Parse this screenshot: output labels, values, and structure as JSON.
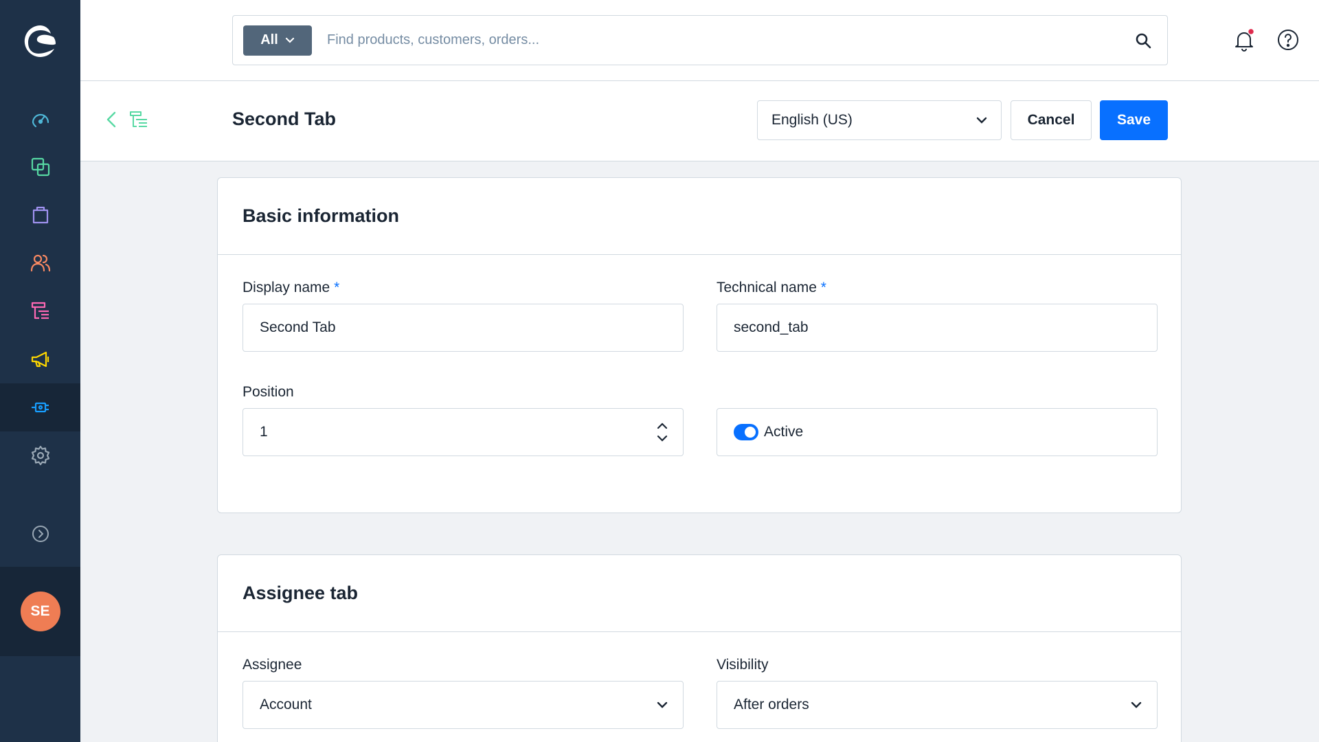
{
  "sidebar": {
    "items": [
      {
        "icon": "dashboard-icon",
        "color": "#4fb8d8"
      },
      {
        "icon": "catalogue-icon",
        "color": "#57d9a3"
      },
      {
        "icon": "orders-icon",
        "color": "#a092f0"
      },
      {
        "icon": "customers-icon",
        "color": "#f88962"
      },
      {
        "icon": "content-icon",
        "color": "#ff68b4"
      },
      {
        "icon": "marketing-icon",
        "color": "#ffd700"
      },
      {
        "icon": "extensions-icon",
        "color": "#189eff",
        "active": true
      },
      {
        "icon": "settings-icon",
        "color": "#9aa8b5"
      }
    ],
    "expand_icon": "chevron-right-circle-icon",
    "avatar_initials": "SE",
    "avatar_color": "#ef7d54"
  },
  "search": {
    "type_label": "All",
    "placeholder": "Find products, customers, orders..."
  },
  "header": {
    "title": "Second Tab",
    "language": "English (US)",
    "cancel_label": "Cancel",
    "save_label": "Save"
  },
  "basic_info": {
    "title": "Basic information",
    "display_name_label": "Display name",
    "display_name_value": "Second Tab",
    "technical_name_label": "Technical name",
    "technical_name_value": "second_tab",
    "required_marker": "*",
    "position_label": "Position",
    "position_value": "1",
    "active_label": "Active",
    "active": true
  },
  "assignee_tab": {
    "title": "Assignee tab",
    "assignee_label": "Assignee",
    "assignee_value": "Account",
    "visibility_label": "Visibility",
    "visibility_value": "After orders"
  },
  "colors": {
    "sidebar": "#1e3148",
    "primary": "#0870ff",
    "notification_dot": "#de294c"
  }
}
